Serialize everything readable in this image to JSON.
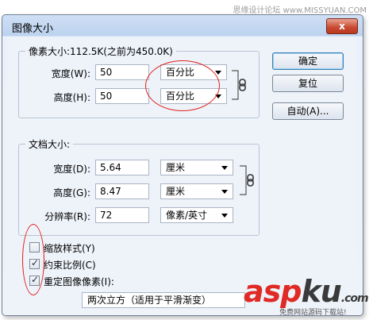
{
  "watermark_top": "思缘设计论坛 www.MISSYUAN.COM",
  "dialog": {
    "title": "图像大小",
    "close_glyph": "x"
  },
  "pixel_dimensions": {
    "legend": "像素大小:112.5K(之前为450.0K)",
    "width_label": "宽度(W):",
    "width_value": "50",
    "width_unit": "百分比",
    "height_label": "高度(H):",
    "height_value": "50",
    "height_unit": "百分比"
  },
  "document_size": {
    "legend": "文档大小:",
    "width_label": "宽度(D):",
    "width_value": "5.64",
    "width_unit": "厘米",
    "height_label": "高度(G):",
    "height_value": "8.47",
    "height_unit": "厘米",
    "resolution_label": "分辨率(R):",
    "resolution_value": "72",
    "resolution_unit": "像素/英寸"
  },
  "buttons": {
    "ok": "确定",
    "reset": "复位",
    "auto": "自动(A)..."
  },
  "options": {
    "scale_styles": {
      "label": "缩放样式(Y)",
      "checked": false
    },
    "constrain_proportions": {
      "label": "约束比例(C)",
      "checked": true
    },
    "resample_image": {
      "label": "重定图像像素(I):",
      "checked": true
    }
  },
  "resample_method": "两次立方（适用于平滑渐变）",
  "brand": {
    "asp": "asp",
    "ku": "ku",
    "suffix": ".com",
    "tagline": "免费网站源码下载站!"
  },
  "colors": {
    "annotation_red": "#e0221e",
    "brand_red": "#e02a25"
  }
}
